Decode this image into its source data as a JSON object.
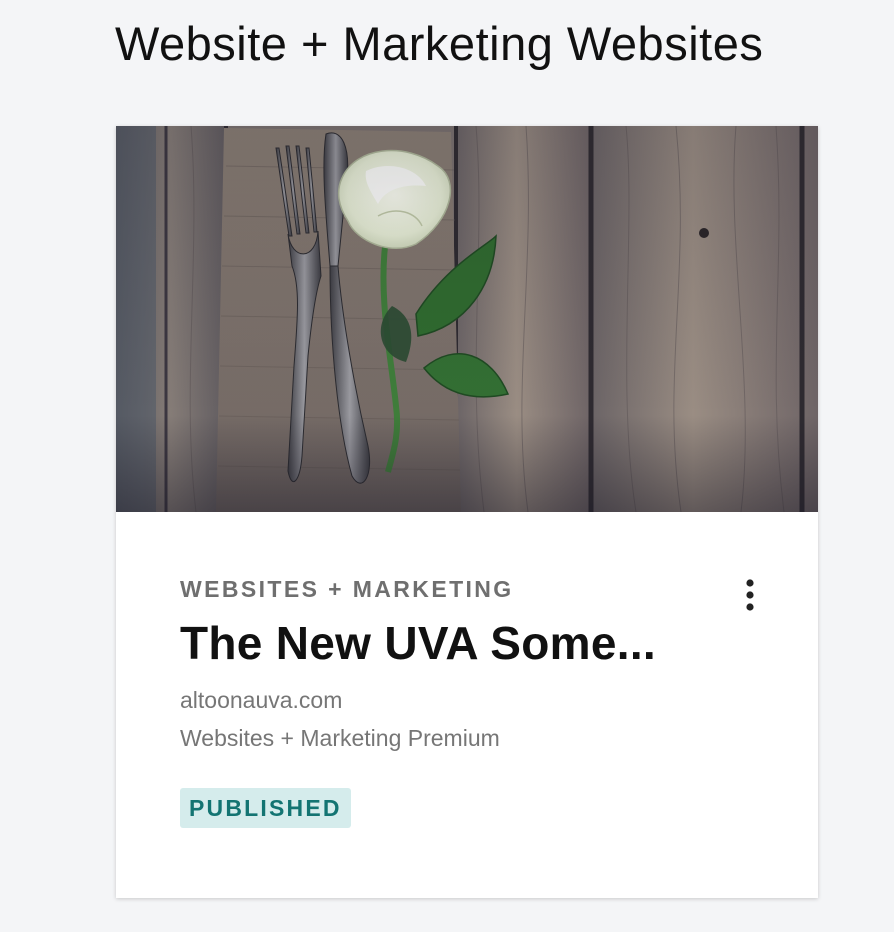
{
  "page": {
    "title": "Website + Marketing Websites"
  },
  "card": {
    "category": "WEBSITES + MARKETING",
    "site_name": "The New UVA Some...",
    "domain": "altoonauva.com",
    "plan": "Websites + Marketing Premium",
    "status": "PUBLISHED",
    "menu_icon": "more-vertical-icon",
    "thumbnail_icon": "site-thumbnail-image"
  },
  "colors": {
    "page_background": "#f4f5f7",
    "badge_background": "#d5ecec",
    "badge_text": "#137472",
    "muted_text": "#767676"
  }
}
